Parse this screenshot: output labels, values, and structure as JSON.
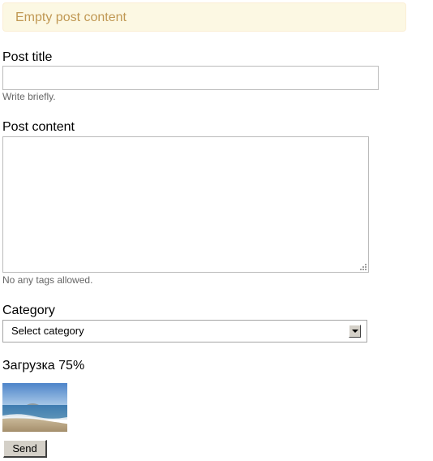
{
  "alert": {
    "message": "Empty post content",
    "background_color": "#fcf8e3",
    "text_color": "#c09853"
  },
  "form": {
    "title": {
      "label": "Post title",
      "value": "",
      "hint": "Write briefly."
    },
    "content": {
      "label": "Post content",
      "value": "",
      "hint": "No any tags allowed."
    },
    "category": {
      "label": "Category",
      "selected": "Select category",
      "icon": "dropdown-arrow-icon"
    },
    "upload": {
      "status": "Загрузка 75%",
      "progress_percent": 75,
      "thumbnail": "beach-sea-photo"
    },
    "submit_label": "Send"
  }
}
